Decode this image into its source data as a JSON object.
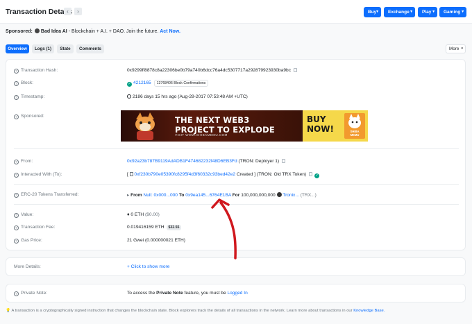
{
  "header": {
    "title": "Transaction Details",
    "nav_buttons": [
      {
        "label": "Buy"
      },
      {
        "label": "Exchange"
      },
      {
        "label": "Play"
      },
      {
        "label": "Gaming"
      }
    ]
  },
  "sponsored_line": {
    "label": "Sponsored:",
    "name": "Bad Idea AI",
    "text": "- Blockchain + A.I. + DAO. Join the future.",
    "cta": "Act Now."
  },
  "tabs": [
    {
      "label": "Overview",
      "active": true
    },
    {
      "label": "Logs (1)",
      "active": false
    },
    {
      "label": "State",
      "active": false
    },
    {
      "label": "Comments",
      "active": false
    }
  ],
  "more_button": "More",
  "overview": {
    "tx_hash_label": "Transaction Hash:",
    "tx_hash": "0x9299ff8878c8a22306be0b79a740b6dcc76a4dc5307717a292879923930ba9bc",
    "block_label": "Block:",
    "block_number": "4212165",
    "block_confirmations": "13768406 Block Confirmations",
    "timestamp_label": "Timestamp:",
    "timestamp": "2186 days 15 hrs ago (Aug-28-2017 07:53:48 AM +UTC)",
    "sponsored_label": "Sponsored:",
    "banner": {
      "line1": "THE NEXT WEB3",
      "line2": "PROJECT TO EXPLODE",
      "url": "VISIT WWW.SHIBAMEMU.COM",
      "cta1": "BUY",
      "cta2": "NOW!",
      "brand1": "SHIBA",
      "brand2": "MEMU"
    },
    "from_label": "From:",
    "from_address": "0x92a23b787B9119AdADB1F474682232f48D6EB3Fd",
    "from_name": "(TRON: Deployer 1)",
    "interacted_label": "Interacted With (To):",
    "interacted_prefix": "[",
    "interacted_address": "0xf230b790e05390fc8295f4d3f60332c93bed42e2",
    "interacted_suffix": "Created ]",
    "interacted_name": "(TRON: Old TRX Token)",
    "erc20_label": "ERC-20 Tokens Transferred:",
    "erc20": {
      "from_word": "From",
      "from_value": "Null: 0x000...000",
      "to_word": "To",
      "to_value": "0x9ea145...6764E1BA",
      "for_word": "For",
      "amount": "100,000,000,000",
      "token": "Tronix...",
      "token_symbol": "(TRX...)"
    },
    "value_label": "Value:",
    "value": "0 ETH",
    "value_usd": "($0.00)",
    "fee_label": "Transaction Fee:",
    "fee": "0.019416159 ETH",
    "fee_usd": "$32.55",
    "gas_label": "Gas Price:",
    "gas_price": "21 Gwei",
    "gas_eth": "(0.000000021 ETH)"
  },
  "more_details": {
    "label": "More Details:",
    "link": "+ Click to show more"
  },
  "private_note": {
    "label": "Private Note:",
    "text_before": "To access the",
    "bold": "Private Note",
    "text_mid": "feature, you must be",
    "link": "Logged In"
  },
  "footer": {
    "text": "A transaction is a cryptographically signed instruction that changes the blockchain state. Block explorers track the details of all transactions in the network. Learn more about transactions in our",
    "link": "Knowledge Base."
  },
  "colors": {
    "accent": "#0d6efd",
    "annotation_arrow": "#d0181e",
    "success": "#00a186"
  }
}
